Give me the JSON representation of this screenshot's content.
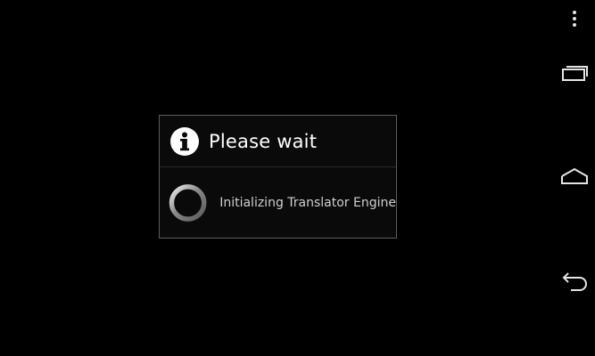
{
  "dialog": {
    "title": "Please wait",
    "message": "Initializing Translator Engine",
    "icon": "info-icon",
    "progress_indicator": "spinner-icon"
  },
  "nav_bar": {
    "buttons": [
      {
        "name": "overflow-menu",
        "icon": "overflow-menu-icon"
      },
      {
        "name": "recent-apps",
        "icon": "recent-apps-icon"
      },
      {
        "name": "home",
        "icon": "home-icon"
      },
      {
        "name": "back",
        "icon": "back-icon"
      }
    ]
  },
  "colors": {
    "background": "#000000",
    "dialog_border": "#5c5c5c",
    "title_text": "#ffffff",
    "message_text": "#cfcfcf",
    "icon_fill": "#ffffff",
    "spinner_ring": "#9a9a9a"
  }
}
